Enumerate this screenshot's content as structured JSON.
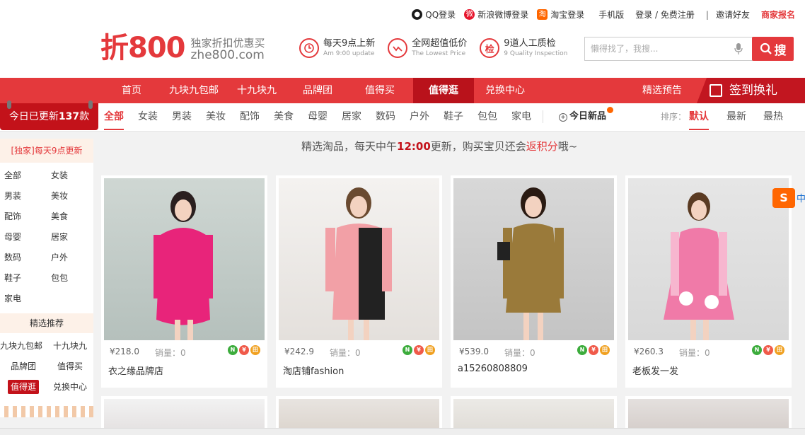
{
  "top_links": {
    "qq": "QQ登录",
    "weibo": "新浪微博登录",
    "taobao": "淘宝登录",
    "mobile": "手机版",
    "login": "登录 / 免费注册",
    "invite": "邀请好友",
    "merchant": "商家报名"
  },
  "logo": {
    "big": "折800",
    "sub1": "独家折扣优惠买",
    "sub2": "zhe800.com"
  },
  "features": [
    {
      "t1": "每天9点上新",
      "t2": "Am 9:00 update",
      "icon": "clock-icon"
    },
    {
      "t1": "全网超值低价",
      "t2": "The Lowest Price",
      "icon": "trend-down-icon"
    },
    {
      "t1": "9道人工质检",
      "t2": "9 Quality Inspection",
      "icon": "check-icon",
      "glyph": "检"
    }
  ],
  "search": {
    "placeholder": "懒得找了，我搜...",
    "button": "搜"
  },
  "nav": {
    "items": [
      "首页",
      "九块九包邮",
      "十九块九",
      "品牌团",
      "值得买",
      "值得逛",
      "兑换中心"
    ],
    "active": "值得逛",
    "preview": "精选预告",
    "signin": "签到换礼"
  },
  "update_tag": {
    "prefix": "今日已更新",
    "count": "137",
    "suffix": "款"
  },
  "categories": [
    "全部",
    "女装",
    "男装",
    "美妆",
    "配饰",
    "美食",
    "母婴",
    "居家",
    "数码",
    "户外",
    "鞋子",
    "包包",
    "家电"
  ],
  "active_category": "全部",
  "new_today": "今日新品",
  "sort": {
    "label": "排序：",
    "options": [
      "默认",
      "最新",
      "最热"
    ],
    "active": "默认"
  },
  "sidebar": {
    "head": "[独家]每天9点更新",
    "items": [
      "全部",
      "女装",
      "男装",
      "美妆",
      "配饰",
      "美食",
      "母婴",
      "居家",
      "数码",
      "户外",
      "鞋子",
      "包包",
      "家电"
    ],
    "head2": "精选推荐",
    "items2": [
      "九块九包邮",
      "十九块九",
      "品牌团",
      "值得买",
      "值得逛",
      "兑换中心"
    ]
  },
  "tagline": {
    "a": "精选淘品，每天中午",
    "b": "12:00",
    "c": "更新，购买宝贝还会",
    "d": "返积分",
    "e": "哦~"
  },
  "products": [
    {
      "price": "¥218.0",
      "sales": "销量：0",
      "shop": "衣之缘品牌店",
      "color": "#e8247a"
    },
    {
      "price": "¥242.9",
      "sales": "销量：0",
      "shop": "淘店铺fashion",
      "color": "#f2a0a6"
    },
    {
      "price": "¥539.0",
      "sales": "销量：0",
      "shop": "a15260808809",
      "color": "#9a7a3a"
    },
    {
      "price": "¥260.3",
      "sales": "销量：0",
      "shop": "老板发一发",
      "color": "#f07aa8"
    }
  ],
  "colors": {
    "brand": "#e4393c",
    "dark": "#c3121a"
  }
}
